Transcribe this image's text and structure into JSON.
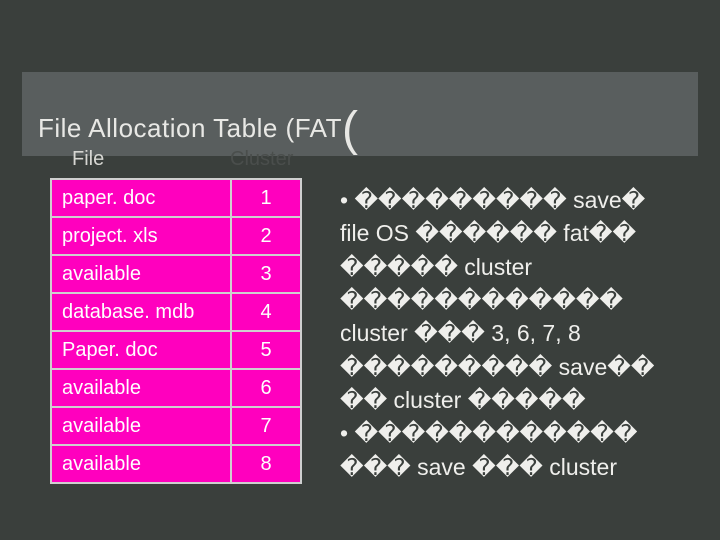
{
  "title_prefix": "File Allocation Table (FAT",
  "title_suffix": "(",
  "headers": {
    "file": "File",
    "cluster": "Cluster"
  },
  "rows": [
    {
      "file": "paper. doc",
      "cluster": "1"
    },
    {
      "file": "project. xls",
      "cluster": "2"
    },
    {
      "file": "available",
      "cluster": "3"
    },
    {
      "file": "database. mdb",
      "cluster": "4"
    },
    {
      "file": "Paper. doc",
      "cluster": "5"
    },
    {
      "file": "available",
      "cluster": "6"
    },
    {
      "file": "available",
      "cluster": "7"
    },
    {
      "file": "available",
      "cluster": "8"
    }
  ],
  "notes": {
    "l1a": "• ��������� save�",
    "l2": "file OS ������ fat��",
    "l3": "����� cluster",
    "l4": "������������",
    "l5": "cluster ��� 3, 6, 7, 8",
    "l6": "��������� save��",
    "l7": "�� cluster �����",
    "l8": "• ������������",
    "l9": "��� save ��� cluster"
  }
}
